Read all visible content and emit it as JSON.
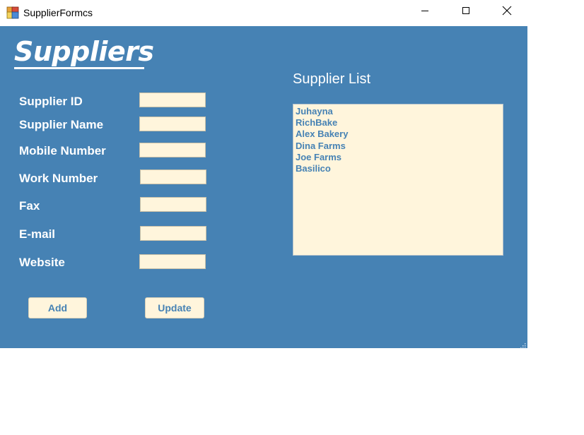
{
  "window": {
    "title": "SupplierFormcs"
  },
  "form": {
    "heading": "Suppliers",
    "labels": {
      "supplier_id": "Supplier ID",
      "supplier_name": "Supplier Name",
      "mobile_number": "Mobile Number",
      "work_number": "Work Number",
      "fax": "Fax",
      "email": "E-mail",
      "website": "Website"
    },
    "values": {
      "supplier_id": "",
      "supplier_name": "",
      "mobile_number": "",
      "work_number": "",
      "fax": "",
      "email": "",
      "website": ""
    },
    "buttons": {
      "add": "Add",
      "update": "Update"
    }
  },
  "supplier_list": {
    "heading": "Supplier List",
    "items": [
      "Juhayna",
      "RichBake",
      "Alex Bakery",
      "Dina Farms",
      "Joe Farms",
      "Basilico"
    ]
  },
  "colors": {
    "background": "#4682b4",
    "input_background": "#fff5dc",
    "list_text": "#4682b4",
    "label_text": "#ffffff"
  },
  "icons": {
    "app": "app-icon",
    "minimize": "minimize-icon",
    "maximize": "maximize-icon",
    "close": "close-icon",
    "resize_grip": "resize-grip-icon"
  }
}
